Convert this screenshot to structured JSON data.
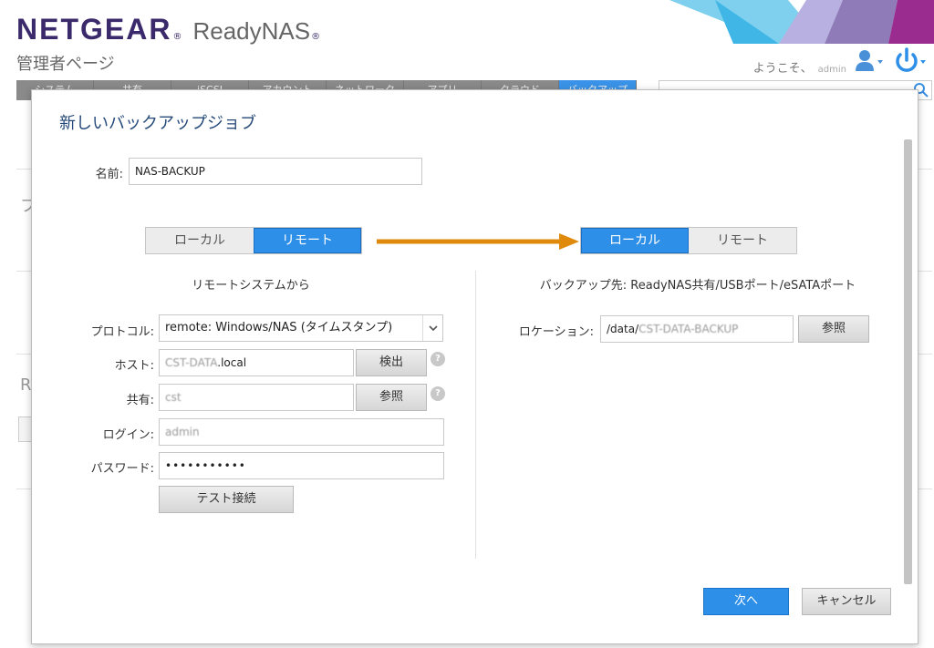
{
  "header": {
    "brand": "NETGEAR",
    "reg_mark": "®",
    "product": "ReadyNAS",
    "product_reg": "®",
    "page_title": "管理者ページ",
    "welcome_text": "ようこそ、",
    "username": "admin"
  },
  "background": {
    "fragment_1": "フ",
    "fragment_2": "R"
  },
  "nav": {
    "tabs": [
      "システム",
      "共有",
      "iSCSI",
      "アカウント",
      "ネットワーク",
      "アプリ",
      "クラウド",
      "バックアップ"
    ],
    "active_index": 7
  },
  "modal": {
    "title": "新しいバックアップジョブ",
    "name_label": "名前:",
    "name_value": "NAS-BACKUP",
    "source": {
      "options": [
        "ローカル",
        "リモート"
      ],
      "selected": "リモート",
      "heading": "リモートシステムから",
      "protocol_label": "プロトコル:",
      "protocol_value": "remote: Windows/NAS (タイムスタンプ)",
      "host_label": "ホスト:",
      "host_value_blurred": "CST-DATA",
      "host_value_suffix": ".local",
      "detect_button": "検出",
      "share_label": "共有:",
      "share_value": "cst",
      "browse_button": "参照",
      "login_label": "ログイン:",
      "login_value": "admin",
      "password_label": "パスワード:",
      "password_value": "•••••••••••",
      "test_button": "テスト接続"
    },
    "destination": {
      "options": [
        "ローカル",
        "リモート"
      ],
      "selected": "ローカル",
      "heading": "バックアップ先: ReadyNAS共有/USBポート/eSATAポート",
      "location_label": "ロケーション:",
      "location_prefix": "/data/",
      "location_blurred": "CST-DATA-BACKUP",
      "browse_button": "参照"
    },
    "help_glyph": "?",
    "next_button": "次へ",
    "cancel_button": "キャンセル"
  },
  "colors": {
    "accent_blue": "#2e8fe8",
    "arrow_orange": "#e08a0b",
    "brand_purple": "#3b2a6b"
  },
  "icons": [
    "user-icon",
    "chevron-down-icon",
    "power-icon",
    "search-icon",
    "arrow-right-icon",
    "help-icon"
  ]
}
